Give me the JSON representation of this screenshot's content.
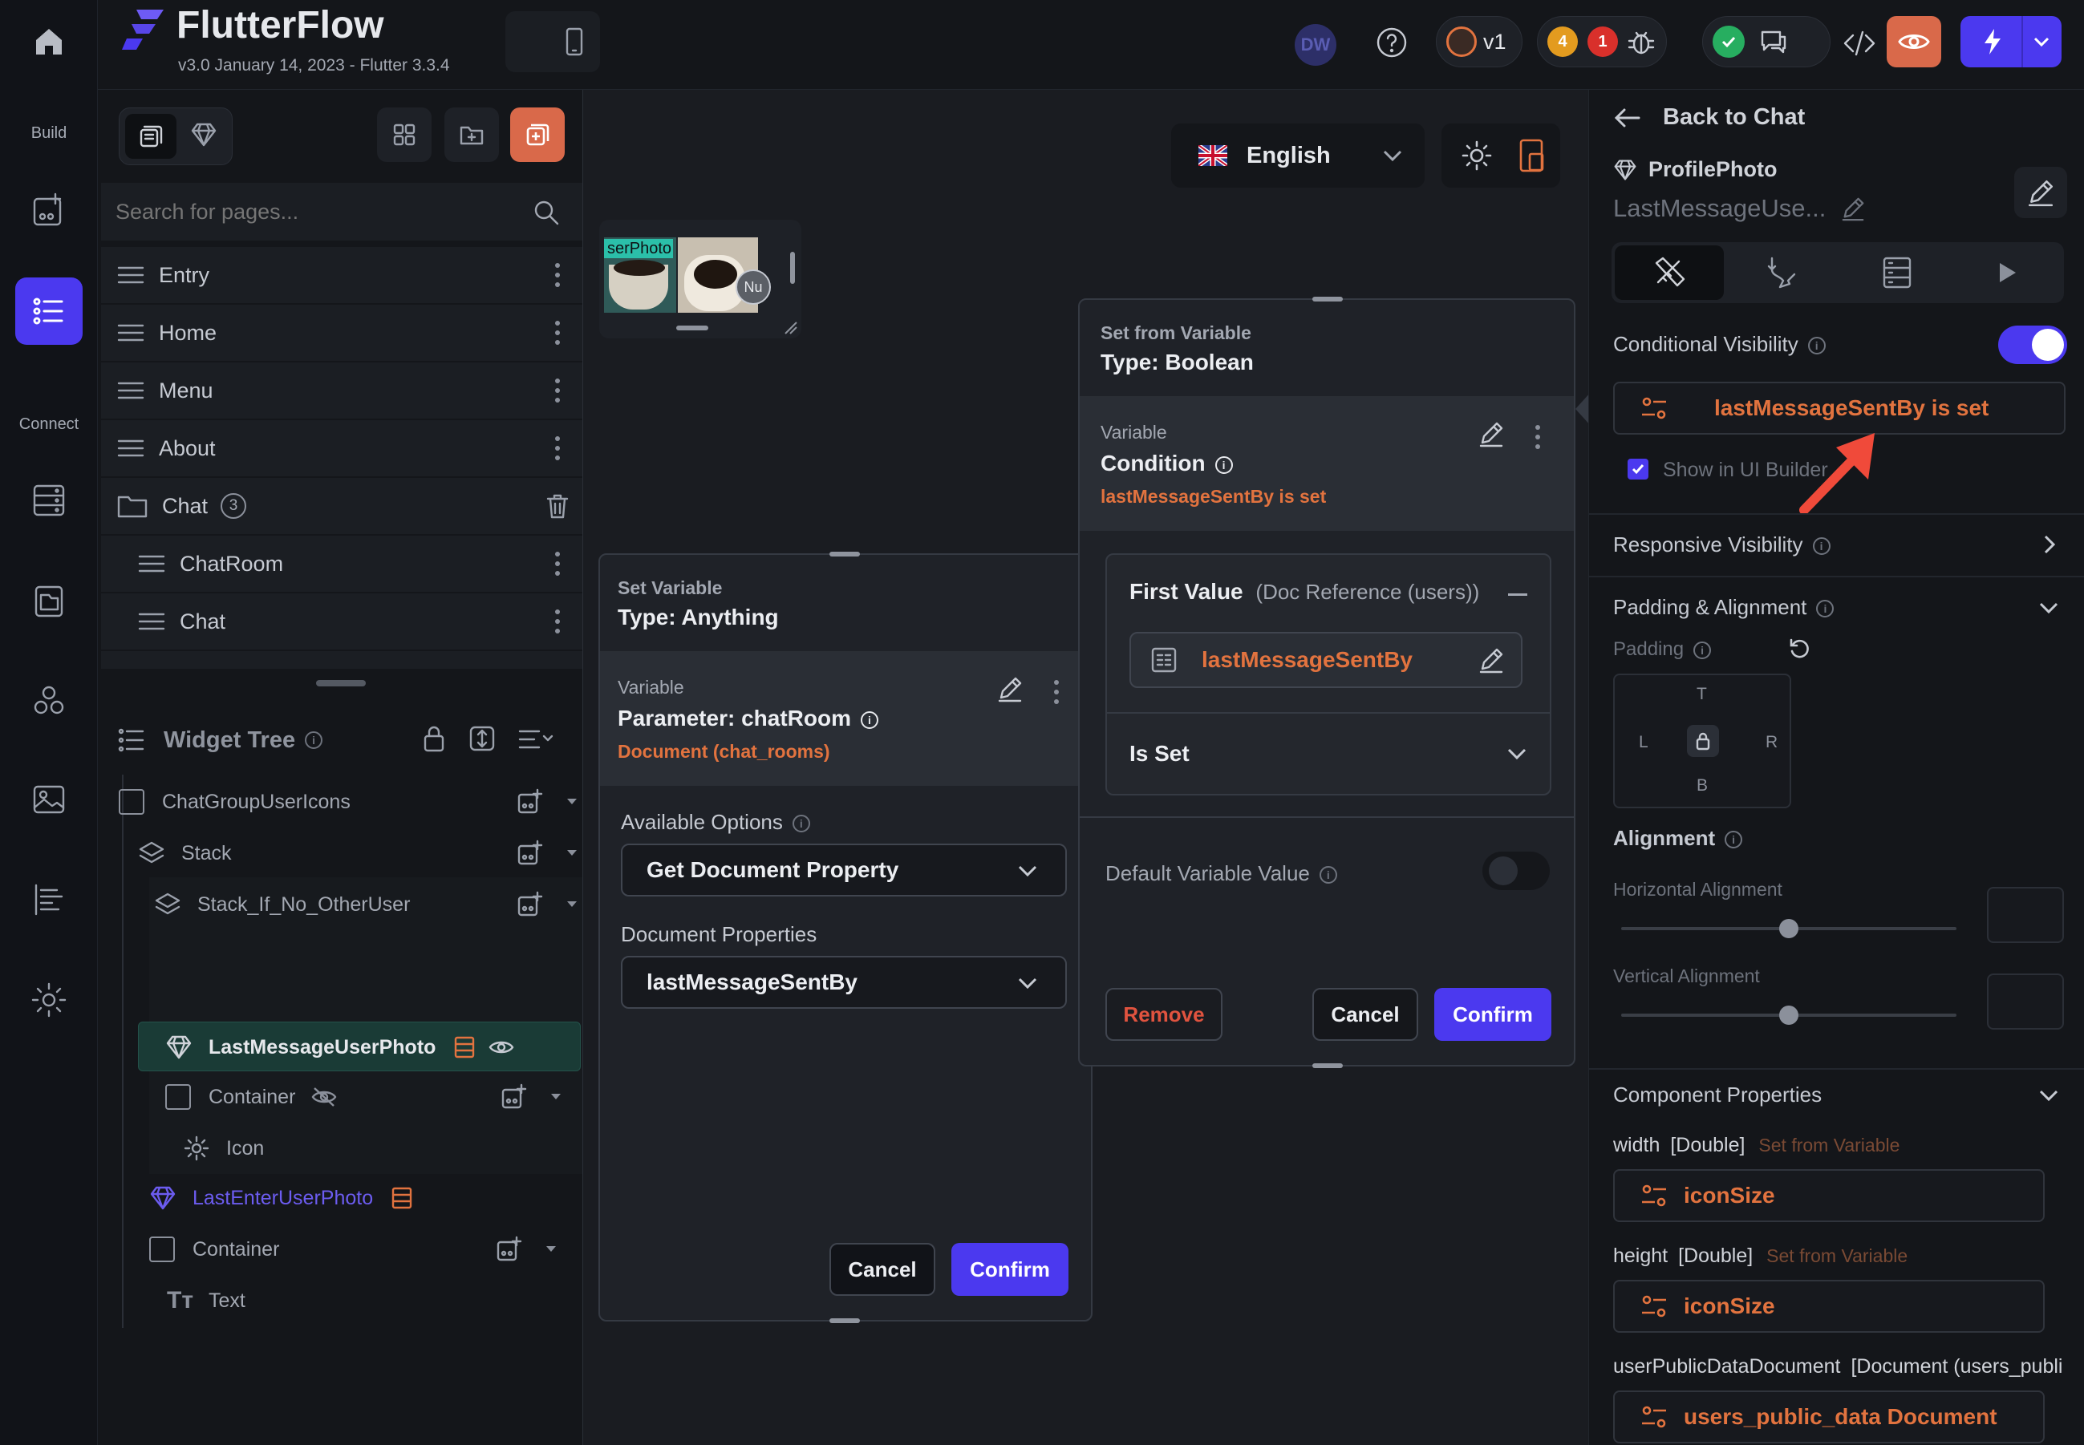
{
  "app": {
    "name": "FlutterFlow",
    "version": "v3.0 January 14, 2023 - Flutter 3.3.4"
  },
  "rail": {
    "build_label": "Build",
    "connect_label": "Connect"
  },
  "topbar": {
    "avatar": "DW",
    "version_badge": "v1",
    "warnings": "4",
    "errors": "1"
  },
  "pages_panel": {
    "search_placeholder": "Search for pages...",
    "pages": [
      "Entry",
      "Home",
      "Menu",
      "About"
    ],
    "folder": {
      "name": "Chat",
      "count": "3"
    },
    "folder_pages": [
      "ChatRoom",
      "Chat"
    ]
  },
  "widget_tree": {
    "title": "Widget Tree",
    "items": [
      "ChatGroupUserIcons",
      "Stack",
      "Stack_If_No_OtherUser",
      "LastMessageUserPhoto",
      "Container",
      "Icon",
      "LastEnterUserPhoto",
      "Container",
      "Text"
    ]
  },
  "canvas": {
    "language": "English",
    "thumb_text": "serPhoto",
    "thumb_badge": "Nu"
  },
  "set_variable": {
    "subtitle": "Set Variable",
    "type": "Type: Anything",
    "variable_label": "Variable",
    "variable_name": "Parameter: chatRoom",
    "variable_type": "Document (chat_rooms)",
    "available_options_label": "Available Options",
    "available_options_value": "Get Document Property",
    "doc_props_label": "Document Properties",
    "doc_props_value": "lastMessageSentBy",
    "cancel": "Cancel",
    "confirm": "Confirm"
  },
  "set_from_variable": {
    "subtitle": "Set from Variable",
    "type": "Type: Boolean",
    "variable_label": "Variable",
    "condition_label": "Condition",
    "condition_value": "lastMessageSentBy is set",
    "first_value_label": "First Value",
    "first_value_type": "(Doc Reference (users))",
    "first_value_field": "lastMessageSentBy",
    "operator": "Is Set",
    "default_label": "Default Variable Value",
    "remove": "Remove",
    "cancel": "Cancel",
    "confirm": "Confirm"
  },
  "properties": {
    "back": "Back to Chat",
    "component": "ProfilePhoto",
    "widget_name": "LastMessageUse...",
    "conditional_visibility_label": "Conditional Visibility",
    "conditional_visibility_value": "lastMessageSentBy is set",
    "show_in_builder": "Show in UI Builder",
    "responsive_visibility": "Responsive Visibility",
    "padding_alignment": "Padding & Alignment",
    "padding": "Padding",
    "pad_t": "T",
    "pad_l": "L",
    "pad_r": "R",
    "pad_b": "B",
    "alignment": "Alignment",
    "horizontal_alignment": "Horizontal Alignment",
    "horizontal_value": 0.5,
    "vertical_alignment": "Vertical Alignment",
    "vertical_value": 0.5,
    "component_properties": "Component Properties",
    "width_label": "width",
    "width_type": "[Double]",
    "width_source": "Set from Variable",
    "width_value": "iconSize",
    "height_label": "height",
    "height_type": "[Double]",
    "height_source": "Set from Variable",
    "height_value": "iconSize",
    "doc_label": "userPublicDataDocument",
    "doc_type": "[Document (users_publi",
    "doc_value": "users_public_data Document"
  },
  "colors": {
    "accent": "#4b39ef",
    "orange": "#e2733f",
    "danger": "#e0533f",
    "success": "#27ae60"
  }
}
